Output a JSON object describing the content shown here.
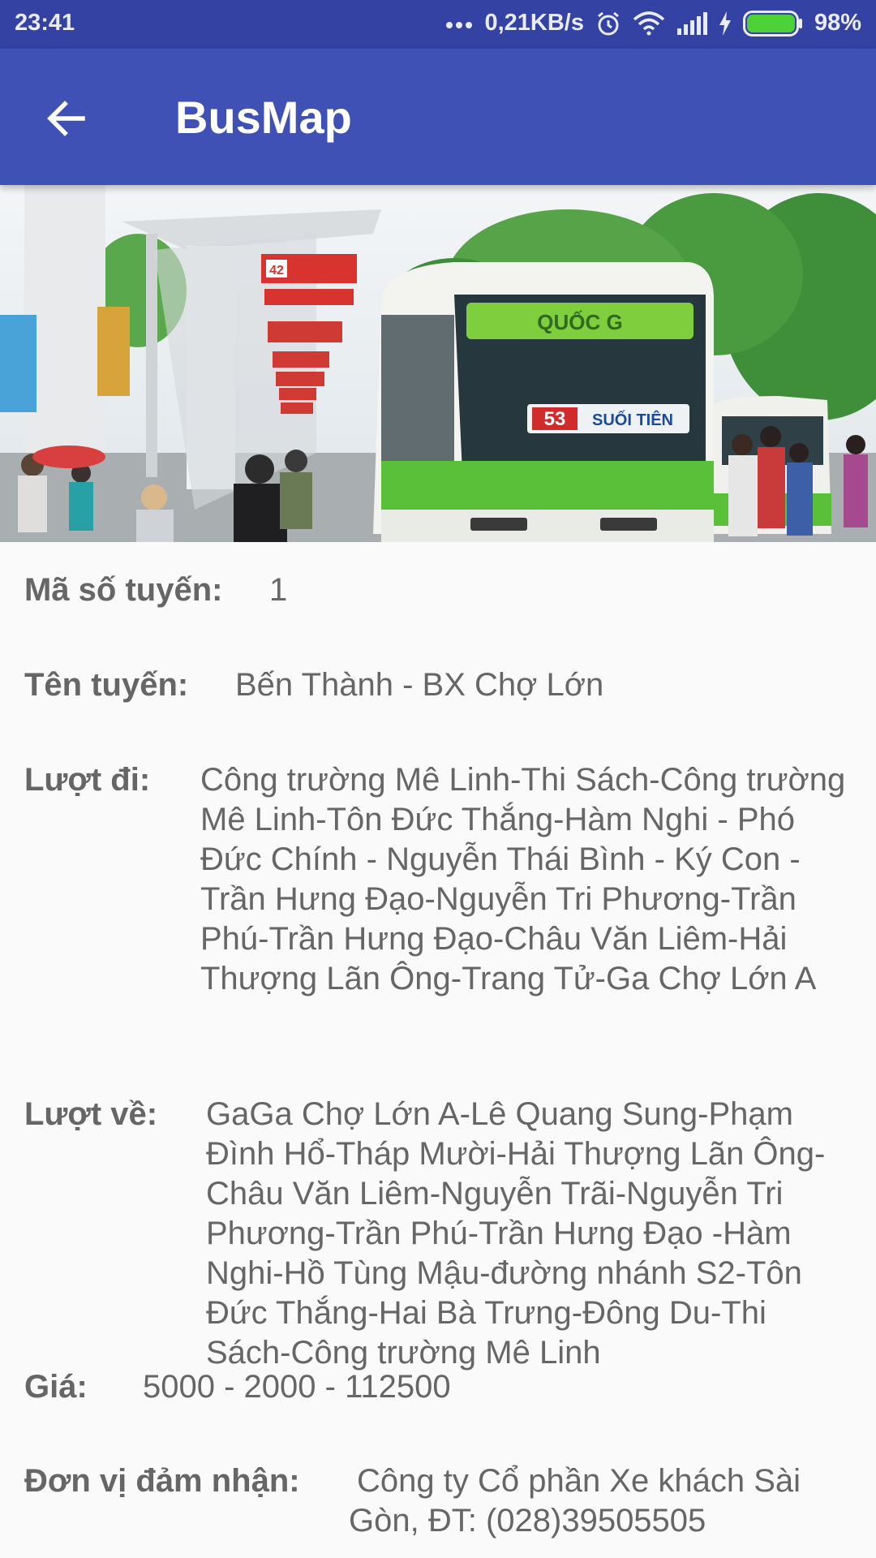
{
  "status_bar": {
    "time": "23:41",
    "network_speed": "0,21KB/s",
    "battery": "98%",
    "icons": [
      "more-dots-icon",
      "alarm-icon",
      "wifi-icon",
      "signal-icon",
      "charging-icon",
      "battery-icon"
    ]
  },
  "app_bar": {
    "title": "BusMap",
    "back_icon": "arrow-back-icon"
  },
  "route": {
    "code_label": "Mã số tuyến:",
    "code_value": "1",
    "name_label": "Tên tuyến:",
    "name_value": "Bến Thành - BX Chợ Lớn",
    "outbound_label": "Lượt đi:",
    "outbound_value": "Công trường Mê Linh-Thi Sách-Công trường Mê Linh-Tôn Đức Thắng-Hàm Nghi - Phó Đức Chính - Nguyễn Thái Bình - Ký Con - Trần Hưng Đạo-Nguyễn Tri Phương-Trần Phú-Trần Hưng Đạo-Châu Văn Liêm-Hải Thượng Lãn Ông-Trang Tử-Ga Chợ Lớn A",
    "return_label": "Lượt về:",
    "return_value": "GaGa Chợ Lớn A-Lê Quang Sung-Phạm Đình Hổ-Tháp Mười-Hải Thượng Lãn Ông-Châu Văn Liêm-Nguyễn Trãi-Nguyễn Tri Phương-Trần Phú-Trần Hưng Đạo -Hàm Nghi-Hồ Tùng Mậu-đường nhánh S2-Tôn Đức Thắng-Hai Bà Trưng-Đông Du-Thi Sách-Công trường Mê Linh",
    "price_label": "Giá:",
    "price_value": "5000 - 2000 - 112500",
    "operator_label": "Đơn vị đảm nhận:",
    "operator_value": "Công ty Cổ phần Xe khách Sài Gòn, ĐT: (028)39505505"
  },
  "hero": {
    "bus_route_number": "53",
    "bus_destination": "SUỐI TIÊN",
    "bus_sign": "QUỐC G",
    "stop_sign": "42"
  },
  "colors": {
    "status_bar": "#3342a3",
    "app_bar": "#3f51b5",
    "background": "#fafafa",
    "text": "#666666"
  }
}
